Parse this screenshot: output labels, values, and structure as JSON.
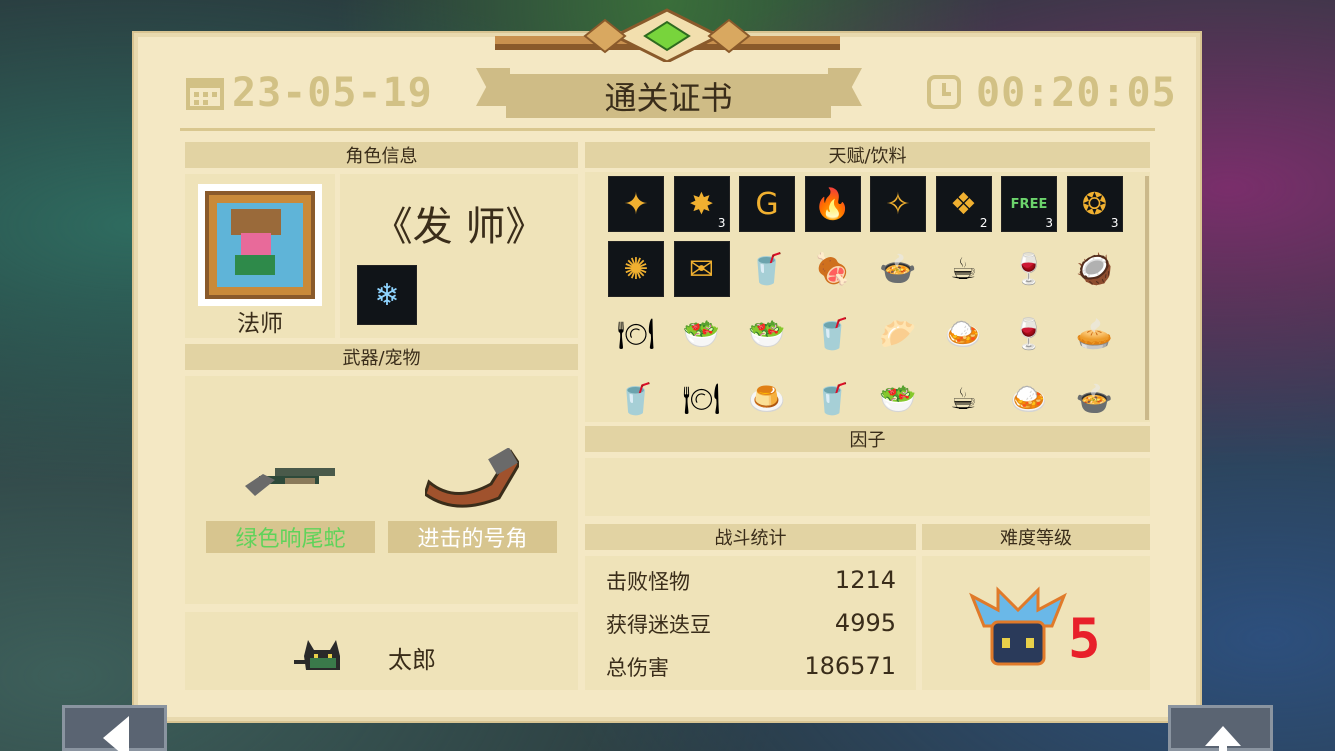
{
  "header": {
    "title": "通关证书",
    "date": "23-05-19",
    "time": "00:20:05",
    "icons": {
      "date": "calendar-icon",
      "time": "clock-icon"
    }
  },
  "character": {
    "section_title": "角色信息",
    "name": "法师",
    "skin": "《发 师》"
  },
  "weapons": {
    "section_title": "武器/宠物",
    "items": [
      {
        "name": "绿色响尾蛇",
        "color": "#5fd35a",
        "icon": "shotgun-icon"
      },
      {
        "name": "进击的号角",
        "color": "#ffffff",
        "icon": "horn-icon"
      }
    ],
    "pet": {
      "name": "太郎",
      "icon": "cat-pet-icon"
    }
  },
  "talents": {
    "section_title": "天赋/饮料",
    "rows": [
      [
        {
          "glyph": "✦",
          "label": "",
          "bg": "dark"
        },
        {
          "glyph": "✸",
          "label": "3",
          "bg": "dark"
        },
        {
          "glyph": "G",
          "label": "",
          "bg": "dark"
        },
        {
          "glyph": "🔥",
          "label": "",
          "bg": "dark"
        },
        {
          "glyph": "✧",
          "label": "",
          "bg": "dark"
        },
        {
          "glyph": "❖",
          "label": "2",
          "bg": "dark"
        },
        {
          "glyph": "FREE",
          "label": "3",
          "bg": "dark"
        },
        {
          "glyph": "❂",
          "label": "3",
          "bg": "dark"
        }
      ],
      [
        {
          "glyph": "✺",
          "label": "",
          "bg": "dark"
        },
        {
          "glyph": "✉",
          "label": "",
          "bg": "dark"
        },
        {
          "glyph": "🥤",
          "label": "",
          "bg": "none"
        },
        {
          "glyph": "🍖",
          "label": "",
          "bg": "none"
        },
        {
          "glyph": "🍲",
          "label": "",
          "bg": "none"
        },
        {
          "glyph": "☕",
          "label": "",
          "bg": "none"
        },
        {
          "glyph": "🍷",
          "label": "",
          "bg": "none"
        },
        {
          "glyph": "🥥",
          "label": "",
          "bg": "none"
        }
      ],
      [
        {
          "glyph": "🍽",
          "label": "",
          "bg": "none"
        },
        {
          "glyph": "🥗",
          "label": "",
          "bg": "none"
        },
        {
          "glyph": "🥗",
          "label": "",
          "bg": "none"
        },
        {
          "glyph": "🥤",
          "label": "",
          "bg": "none"
        },
        {
          "glyph": "🥟",
          "label": "",
          "bg": "none"
        },
        {
          "glyph": "🍛",
          "label": "",
          "bg": "none"
        },
        {
          "glyph": "🍷",
          "label": "",
          "bg": "none"
        },
        {
          "glyph": "🥧",
          "label": "",
          "bg": "none"
        }
      ],
      [
        {
          "glyph": "🥤",
          "label": "",
          "bg": "none"
        },
        {
          "glyph": "🍽",
          "label": "",
          "bg": "none"
        },
        {
          "glyph": "🍮",
          "label": "",
          "bg": "none"
        },
        {
          "glyph": "🥤",
          "label": "",
          "bg": "none"
        },
        {
          "glyph": "🥗",
          "label": "",
          "bg": "none"
        },
        {
          "glyph": "☕",
          "label": "",
          "bg": "none"
        },
        {
          "glyph": "🍛",
          "label": "",
          "bg": "none"
        },
        {
          "glyph": "🍲",
          "label": "",
          "bg": "none"
        }
      ]
    ]
  },
  "factors": {
    "section_title": "因子"
  },
  "stats": {
    "section_title": "战斗统计",
    "rows": [
      {
        "label": "击败怪物",
        "value": "1214"
      },
      {
        "label": "获得迷迭豆",
        "value": "4995"
      },
      {
        "label": "总伤害",
        "value": "186571"
      }
    ]
  },
  "difficulty": {
    "section_title": "难度等级",
    "level": "5",
    "color": "#e8202a"
  },
  "colors": {
    "card": "#f4e8c4",
    "header_text": "#d2c185",
    "accent_green": "#5fd35a"
  }
}
